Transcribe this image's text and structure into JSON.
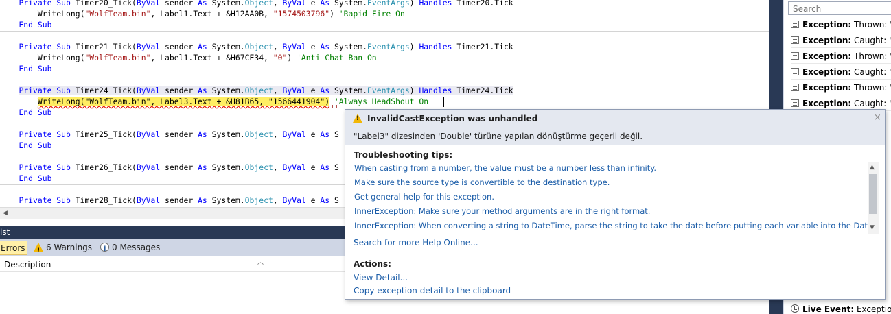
{
  "code": {
    "lines": [
      {
        "parts": [
          {
            "t": "    "
          },
          {
            "t": "Private Sub",
            "c": "kw"
          },
          {
            "t": " Timer20_Tick("
          },
          {
            "t": "ByVal",
            "c": "kw"
          },
          {
            "t": " sender "
          },
          {
            "t": "As",
            "c": "kw"
          },
          {
            "t": " System."
          },
          {
            "t": "Object",
            "c": "ty"
          },
          {
            "t": ", "
          },
          {
            "t": "ByVal",
            "c": "kw"
          },
          {
            "t": " e "
          },
          {
            "t": "As",
            "c": "kw"
          },
          {
            "t": " System."
          },
          {
            "t": "EventArgs",
            "c": "ty"
          },
          {
            "t": ") "
          },
          {
            "t": "Handles",
            "c": "kw"
          },
          {
            "t": " Timer20.Tick"
          }
        ]
      },
      {
        "parts": [
          {
            "t": "        WriteLong("
          },
          {
            "t": "\"WolfTeam.bin\"",
            "c": "str"
          },
          {
            "t": ", Label1.Text + &H12AA0B, "
          },
          {
            "t": "\"1574503796\"",
            "c": "str"
          },
          {
            "t": ") "
          },
          {
            "t": "'Rapid Fire On",
            "c": "cm"
          }
        ]
      },
      {
        "parts": [
          {
            "t": "    "
          },
          {
            "t": "End Sub",
            "c": "kw"
          }
        ]
      },
      {
        "parts": [
          {
            "t": "    "
          },
          {
            "t": "Private Sub",
            "c": "kw"
          },
          {
            "t": " Timer21_Tick("
          },
          {
            "t": "ByVal",
            "c": "kw"
          },
          {
            "t": " sender "
          },
          {
            "t": "As",
            "c": "kw"
          },
          {
            "t": " System."
          },
          {
            "t": "Object",
            "c": "ty"
          },
          {
            "t": ", "
          },
          {
            "t": "ByVal",
            "c": "kw"
          },
          {
            "t": " e "
          },
          {
            "t": "As",
            "c": "kw"
          },
          {
            "t": " System."
          },
          {
            "t": "EventArgs",
            "c": "ty"
          },
          {
            "t": ") "
          },
          {
            "t": "Handles",
            "c": "kw"
          },
          {
            "t": " Timer21.Tick"
          }
        ]
      },
      {
        "parts": [
          {
            "t": "        WriteLong("
          },
          {
            "t": "\"WolfTeam.bin\"",
            "c": "str"
          },
          {
            "t": ", Label1.Text + &H67CE34, "
          },
          {
            "t": "\"0\"",
            "c": "str"
          },
          {
            "t": ") "
          },
          {
            "t": "'Anti Chat Ban On",
            "c": "cm"
          }
        ]
      },
      {
        "parts": [
          {
            "t": "    "
          },
          {
            "t": "End Sub",
            "c": "kw"
          }
        ]
      },
      {
        "parts": [
          {
            "t": "    "
          },
          {
            "t": "Private Sub",
            "c": "kw"
          },
          {
            "t": " Timer24_Tick("
          },
          {
            "t": "ByVal",
            "c": "kw"
          },
          {
            "t": " sender "
          },
          {
            "t": "As",
            "c": "kw"
          },
          {
            "t": " System."
          },
          {
            "t": "Object",
            "c": "ty"
          },
          {
            "t": ", "
          },
          {
            "t": "ByVal",
            "c": "kw"
          },
          {
            "t": " e "
          },
          {
            "t": "As",
            "c": "kw"
          },
          {
            "t": " System."
          },
          {
            "t": "EventArgs",
            "c": "ty"
          },
          {
            "t": ") "
          },
          {
            "t": "Handles",
            "c": "kw"
          },
          {
            "t": " Timer24.Tick"
          }
        ],
        "hl": "sub"
      },
      {
        "parts": [
          {
            "t": "        "
          },
          {
            "t": "WriteLong(\"WolfTeam.bin\", Label3.Text + &H81B65, \"1566441904\")",
            "c": "err"
          },
          {
            "t": " "
          },
          {
            "t": "'Always HeadShout On",
            "c": "cm"
          }
        ]
      },
      {
        "parts": [
          {
            "t": "    "
          },
          {
            "t": "End Sub",
            "c": "kw"
          }
        ]
      },
      {
        "parts": [
          {
            "t": "    "
          },
          {
            "t": "Private Sub",
            "c": "kw"
          },
          {
            "t": " Timer25_Tick("
          },
          {
            "t": "ByVal",
            "c": "kw"
          },
          {
            "t": " sender "
          },
          {
            "t": "As",
            "c": "kw"
          },
          {
            "t": " System."
          },
          {
            "t": "Object",
            "c": "ty"
          },
          {
            "t": ", "
          },
          {
            "t": "ByVal",
            "c": "kw"
          },
          {
            "t": " e "
          },
          {
            "t": "As",
            "c": "kw"
          },
          {
            "t": " S"
          }
        ]
      },
      {
        "parts": [
          {
            "t": "    "
          },
          {
            "t": "End Sub",
            "c": "kw"
          }
        ]
      },
      {
        "parts": [
          {
            "t": "    "
          },
          {
            "t": "Private Sub",
            "c": "kw"
          },
          {
            "t": " Timer26_Tick("
          },
          {
            "t": "ByVal",
            "c": "kw"
          },
          {
            "t": " sender "
          },
          {
            "t": "As",
            "c": "kw"
          },
          {
            "t": " System."
          },
          {
            "t": "Object",
            "c": "ty"
          },
          {
            "t": ", "
          },
          {
            "t": "ByVal",
            "c": "kw"
          },
          {
            "t": " e "
          },
          {
            "t": "As",
            "c": "kw"
          },
          {
            "t": " S"
          }
        ]
      },
      {
        "parts": [
          {
            "t": "    "
          },
          {
            "t": "End Sub",
            "c": "kw"
          }
        ]
      },
      {
        "parts": [
          {
            "t": "    "
          },
          {
            "t": "Private Sub",
            "c": "kw"
          },
          {
            "t": " Timer28_Tick("
          },
          {
            "t": "ByVal",
            "c": "kw"
          },
          {
            "t": " sender "
          },
          {
            "t": "As",
            "c": "kw"
          },
          {
            "t": " System."
          },
          {
            "t": "Object",
            "c": "ty"
          },
          {
            "t": ", "
          },
          {
            "t": "ByVal",
            "c": "kw"
          },
          {
            "t": " e "
          },
          {
            "t": "As",
            "c": "kw"
          },
          {
            "t": " S"
          }
        ]
      }
    ]
  },
  "error_list": {
    "title": "ist",
    "errors_label": "Errors",
    "warnings_label": "6 Warnings",
    "messages_label": "0 Messages",
    "column_description": "Description"
  },
  "exception": {
    "title": "InvalidCastException was unhandled",
    "message": "\"Label3\" dizesinden 'Double' türüne yapılan dönüştürme geçerli değil.",
    "tips_heading": "Troubleshooting tips:",
    "tips": [
      "When casting from a number, the value must be a number less than infinity.",
      "Make sure the source type is convertible to the destination type.",
      "Get general help for this exception.",
      "InnerException: Make sure your method arguments are in the right format.",
      "InnerException: When converting a string to DateTime, parse the string to take the date before putting each variable into the DateTime object."
    ],
    "search_online": "Search for more Help Online...",
    "actions_heading": "Actions:",
    "view_detail": "View Detail...",
    "copy_detail": "Copy exception detail to the clipboard",
    "close_glyph": "×"
  },
  "events": {
    "search_placeholder": "Search",
    "items": [
      {
        "kind": "Exception:",
        "text": " Thrown: \"Ne"
      },
      {
        "kind": "Exception:",
        "text": " Caught: \"Ne"
      },
      {
        "kind": "Exception:",
        "text": " Thrown: \"Diz"
      },
      {
        "kind": "Exception:",
        "text": " Caught: \"Diz"
      },
      {
        "kind": "Exception:",
        "text": " Thrown: \"Ne"
      },
      {
        "kind": "Exception:",
        "text": " Caught: \"Ne"
      }
    ],
    "live_event": {
      "kind": "Live Event:",
      "text": " Exception In"
    }
  },
  "colors": {
    "keyword": "#0000ff",
    "type": "#2b91af",
    "string": "#a31515",
    "comment": "#008000",
    "tool_window_title": "#293955",
    "link": "#1a5ca8",
    "error_highlight": "#ffee62"
  }
}
